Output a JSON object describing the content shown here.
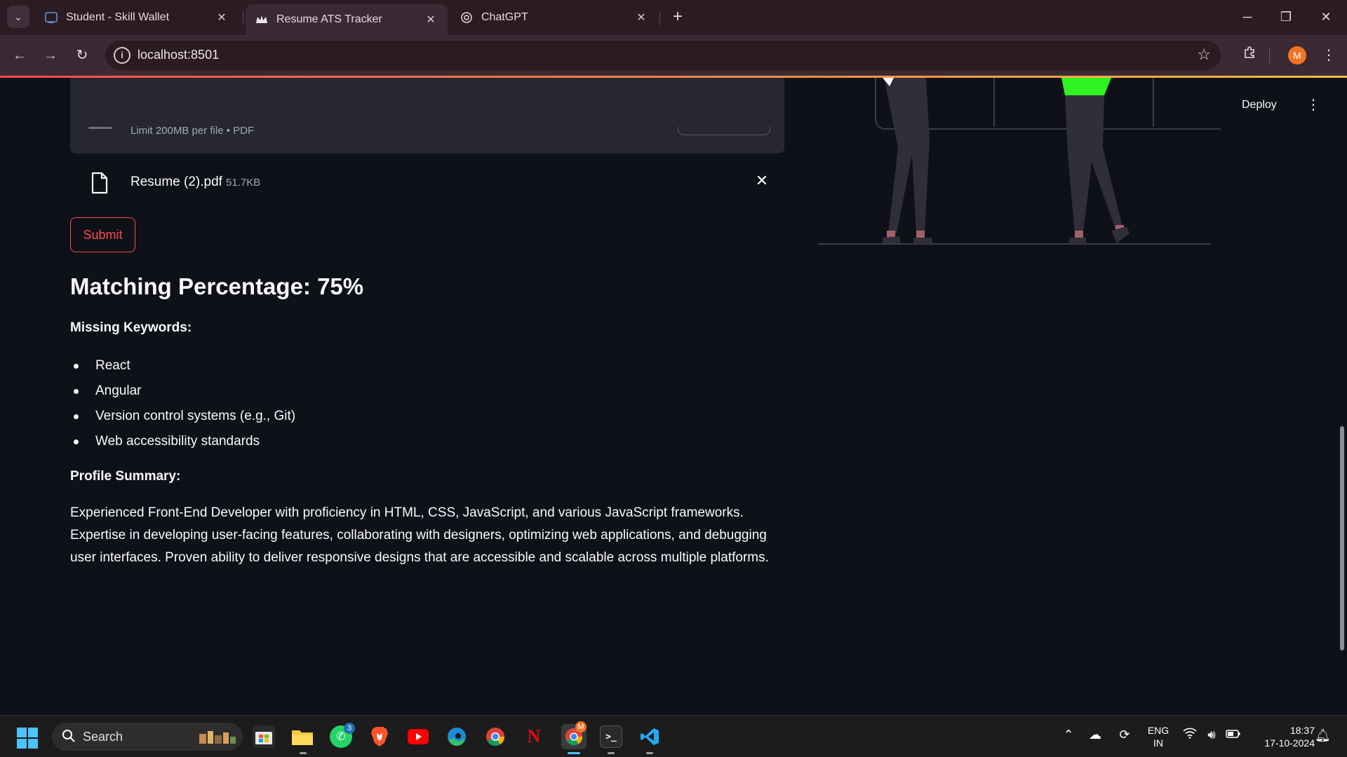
{
  "browser": {
    "tabs": [
      {
        "label": "Student - Skill Wallet",
        "icon": "skill-wallet-icon",
        "active": false
      },
      {
        "label": "Resume ATS Tracker",
        "icon": "streamlit-crown-icon",
        "active": true
      },
      {
        "label": "ChatGPT",
        "icon": "chatgpt-icon",
        "active": false
      }
    ],
    "url": "localhost:8501",
    "profile_initial": "M"
  },
  "header": {
    "deploy_label": "Deploy"
  },
  "uploader": {
    "limit_text": "Limit 200MB per file • PDF",
    "file_name": "Resume (2).pdf",
    "file_size": "51.7KB"
  },
  "form": {
    "submit_label": "Submit"
  },
  "result": {
    "title": "Matching Percentage: 75%",
    "missing_label": "Missing Keywords:",
    "missing_keywords": [
      "React",
      "Angular",
      "Version control systems (e.g., Git)",
      "Web accessibility standards"
    ],
    "summary_label": "Profile Summary:",
    "summary_text": "Experienced Front-End Developer with proficiency in HTML, CSS, JavaScript, and various JavaScript frameworks. Expertise in developing user-facing features, collaborating with designers, optimizing web applications, and debugging user interfaces. Proven ability to deliver responsive designs that are accessible and scalable across multiple platforms."
  },
  "taskbar": {
    "search_label": "Search",
    "whatsapp_badge": "3",
    "chrome_badge": "M",
    "lang_line1": "ENG",
    "lang_line2": "IN",
    "time": "18:37",
    "date": "17-10-2024"
  },
  "colors": {
    "accent": "#ff4b4b",
    "background": "#0e1117",
    "uploader_bg": "#262730",
    "illustration_green": "#2ff321"
  }
}
